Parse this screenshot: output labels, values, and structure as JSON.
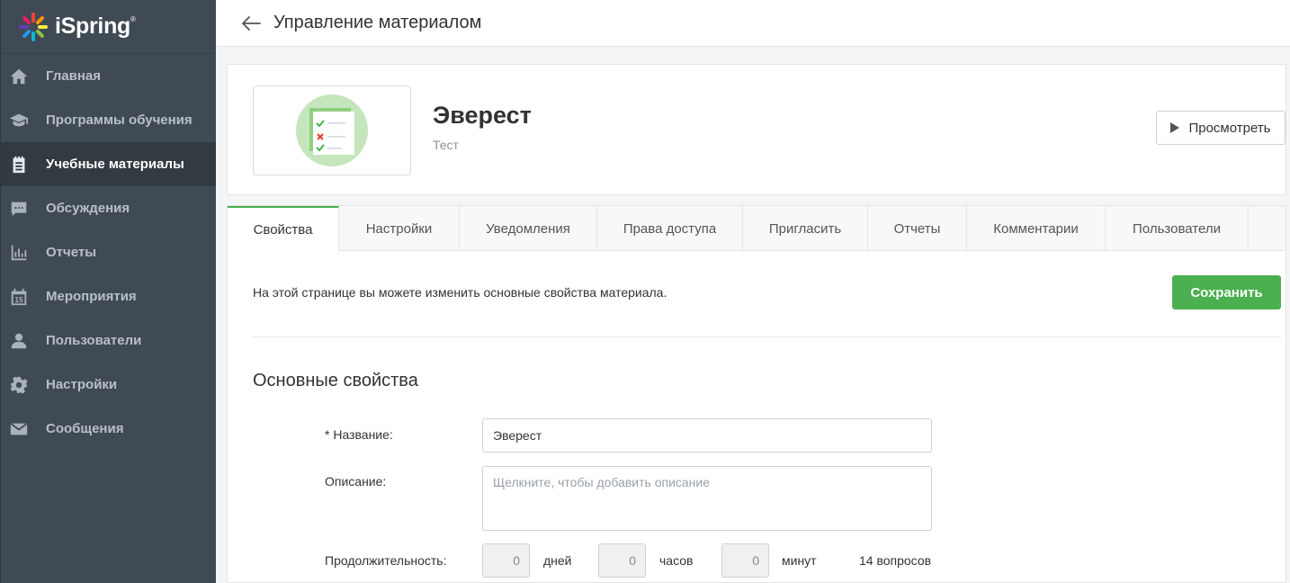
{
  "brand": {
    "name": "iSpring",
    "mark": "®"
  },
  "sidebar": {
    "items": [
      {
        "label": "Главная",
        "icon": "home-icon",
        "active": false
      },
      {
        "label": "Программы обучения",
        "icon": "graduation-cap-icon",
        "active": false
      },
      {
        "label": "Учебные материалы",
        "icon": "notepad-icon",
        "active": true
      },
      {
        "label": "Обсуждения",
        "icon": "chat-bubble-icon",
        "active": false
      },
      {
        "label": "Отчеты",
        "icon": "bar-chart-icon",
        "active": false
      },
      {
        "label": "Мероприятия",
        "icon": "calendar-icon",
        "active": false
      },
      {
        "label": "Пользователи",
        "icon": "user-icon",
        "active": false
      },
      {
        "label": "Настройки",
        "icon": "gear-icon",
        "active": false
      },
      {
        "label": "Сообщения",
        "icon": "envelope-icon",
        "active": false
      }
    ],
    "calendar_day": "15"
  },
  "header": {
    "title": "Управление материалом"
  },
  "material": {
    "title": "Эверест",
    "type": "Тест",
    "preview_label": "Просмотреть"
  },
  "tabs": [
    {
      "label": "Свойства",
      "active": true
    },
    {
      "label": "Настройки",
      "active": false
    },
    {
      "label": "Уведомления",
      "active": false
    },
    {
      "label": "Права доступа",
      "active": false
    },
    {
      "label": "Пригласить",
      "active": false
    },
    {
      "label": "Отчеты",
      "active": false
    },
    {
      "label": "Комментарии",
      "active": false
    },
    {
      "label": "Пользователи",
      "active": false
    }
  ],
  "properties": {
    "hint": "На этой странице вы можете изменить основные свойства материала.",
    "save_label": "Сохранить",
    "section_title": "Основные свойства",
    "name_label": "* Название:",
    "name_value": "Эверест",
    "description_label": "Описание:",
    "description_placeholder": "Щелкните, чтобы добавить описание",
    "duration_label": "Продолжительность:",
    "days_value": "0",
    "days_unit": "дней",
    "hours_value": "0",
    "hours_unit": "часов",
    "minutes_value": "0",
    "minutes_unit": "минут",
    "questions_count": "14 вопросов"
  },
  "colors": {
    "sidebar_bg": "#3f4a54",
    "accent_green": "#4caf50"
  }
}
